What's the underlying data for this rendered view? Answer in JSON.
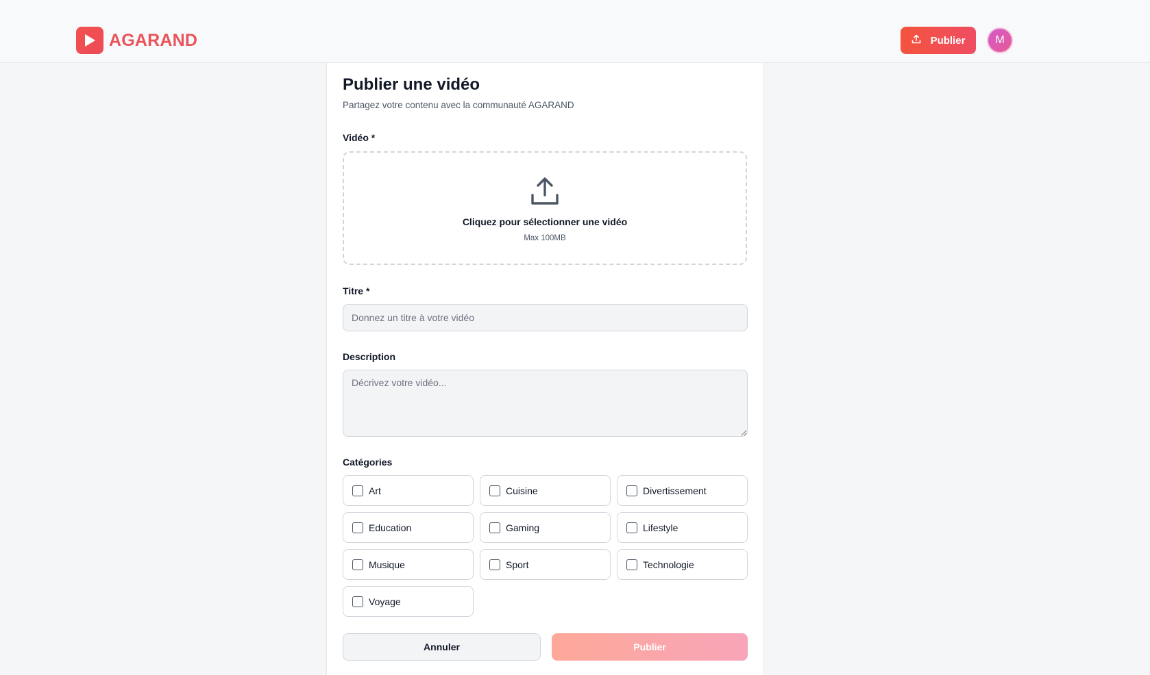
{
  "app": {
    "name": "AGARAND",
    "brand_color": "#ef4d57",
    "accent_gradient": [
      "#f5533d",
      "#ef4d62"
    ]
  },
  "header": {
    "publish_label": "Publier",
    "publish_icon": "upload-icon",
    "avatar_initial": "M"
  },
  "form": {
    "title": "Publier une vidéo",
    "subtitle": "Partagez votre contenu avec la communauté AGARAND",
    "video": {
      "label": "Vidéo *",
      "icon": "upload-icon",
      "prompt": "Cliquez pour sélectionner une vidéo",
      "hint": "Max 100MB"
    },
    "titre": {
      "label": "Titre *",
      "value": "",
      "placeholder": "Donnez un titre à votre vidéo"
    },
    "description": {
      "label": "Description",
      "value": "",
      "placeholder": "Décrivez votre vidéo..."
    },
    "categories": {
      "label": "Catégories",
      "items": [
        {
          "label": "Art",
          "checked": false
        },
        {
          "label": "Cuisine",
          "checked": false
        },
        {
          "label": "Divertissement",
          "checked": false
        },
        {
          "label": "Education",
          "checked": false
        },
        {
          "label": "Gaming",
          "checked": false
        },
        {
          "label": "Lifestyle",
          "checked": false
        },
        {
          "label": "Musique",
          "checked": false
        },
        {
          "label": "Sport",
          "checked": false
        },
        {
          "label": "Technologie",
          "checked": false
        },
        {
          "label": "Voyage",
          "checked": false
        }
      ]
    },
    "cancel_label": "Annuler",
    "submit_label": "Publier"
  }
}
